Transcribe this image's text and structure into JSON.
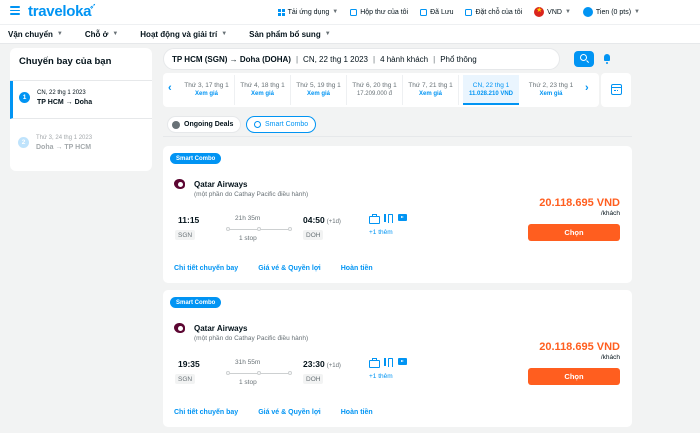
{
  "header": {
    "logo": "traveloka",
    "menu_items": [
      {
        "label": "Tải ứng dụng",
        "icon": "grid-icon"
      },
      {
        "label": "Hộp thư của tôi",
        "icon": "inbox-icon"
      },
      {
        "label": "Đã Lưu",
        "icon": "bookmark-icon"
      },
      {
        "label": "Đặt chỗ của tôi",
        "icon": "booking-icon"
      }
    ],
    "currency": "VND",
    "user": "Tien (0 pts)"
  },
  "nav": {
    "items": [
      {
        "label": "Vận chuyển"
      },
      {
        "label": "Chỗ ở"
      },
      {
        "label": "Hoạt động và giải trí"
      },
      {
        "label": "Sản phẩm bổ sung"
      }
    ]
  },
  "itinerary": {
    "title": "Chuyến bay của bạn",
    "legs": [
      {
        "num": "1",
        "date": "CN, 22 thg 1 2023",
        "route": "TP HCM → Doha"
      },
      {
        "num": "2",
        "date": "Thứ 3, 24 thg 1 2023",
        "route": "Doha → TP HCM"
      }
    ]
  },
  "search_summary": {
    "route": "TP HCM (SGN) → Doha (DOHA)",
    "date": "CN, 22 thg 1 2023",
    "passengers": "4 hành khách",
    "cabin": "Phổ thông",
    "separator": "|"
  },
  "date_strip": [
    {
      "date": "Thứ 3, 17 thg 1",
      "price": "Xem giá",
      "has_value": false
    },
    {
      "date": "Thứ 4, 18 thg 1",
      "price": "Xem giá",
      "has_value": false
    },
    {
      "date": "Thứ 5, 19 thg 1",
      "price": "Xem giá",
      "has_value": false
    },
    {
      "date": "Thứ 6, 20 thg 1",
      "price": "17.209.000 đ",
      "has_value": true
    },
    {
      "date": "Thứ 7, 21 thg 1",
      "price": "Xem giá",
      "has_value": false
    },
    {
      "date": "CN, 22 thg 1",
      "price": "11.028.210 VND",
      "has_value": true,
      "active": true
    },
    {
      "date": "Thứ 2, 23 thg 1",
      "price": "Xem giá",
      "has_value": false
    }
  ],
  "filters": {
    "ongoing_deals": "Ongoing Deals",
    "smart_combo": "Smart Combo"
  },
  "flights": [
    {
      "badge": "Smart Combo",
      "airline": "Qatar Airways",
      "operated_by": "(một phần do Cathay Pacific điều hành)",
      "dep_time": "11:15",
      "dep_code": "SGN",
      "duration": "21h 35m",
      "stops": "1 stop",
      "arr_time": "04:50",
      "plus_day": "(+1d)",
      "arr_code": "DOH",
      "more": "+1 thêm",
      "price": "20.118.695 VND",
      "per_pax": "/khách",
      "select": "Chọn",
      "links": [
        "Chi tiết chuyến bay",
        "Giá vé & Quyền lợi",
        "Hoàn tiền"
      ]
    },
    {
      "badge": "Smart Combo",
      "airline": "Qatar Airways",
      "operated_by": "(một phần do Cathay Pacific điều hành)",
      "dep_time": "19:35",
      "dep_code": "SGN",
      "duration": "31h 55m",
      "stops": "1 stop",
      "arr_time": "23:30",
      "plus_day": "(+1d)",
      "arr_code": "DOH",
      "more": "+1 thêm",
      "price": "20.118.695 VND",
      "per_pax": "/khách",
      "select": "Chọn",
      "links": [
        "Chi tiết chuyến bay",
        "Giá vé & Quyền lợi",
        "Hoàn tiền"
      ]
    }
  ],
  "colors": {
    "brand": "#0194f3",
    "price": "#ff5e1f",
    "cta": "#ff5e1f",
    "background": "#f2f3f3"
  }
}
